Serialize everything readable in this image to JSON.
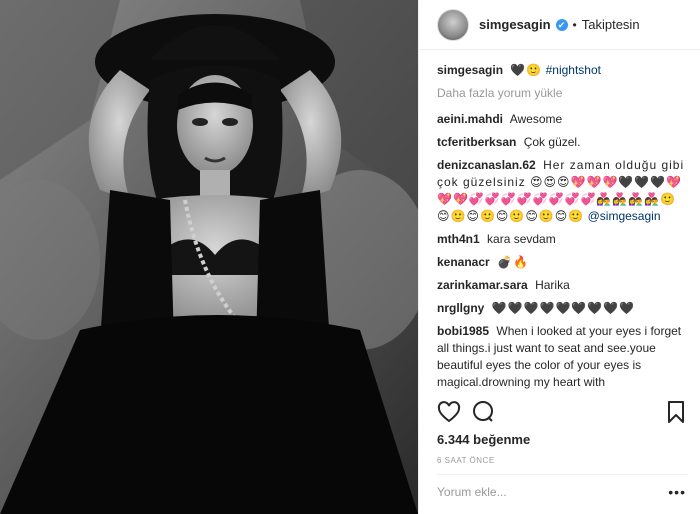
{
  "post": {
    "photo_alt": "",
    "author": {
      "username": "simgesagin",
      "verified_icon": "verified-badge-icon",
      "status": "Takiptesin",
      "separator": "•"
    },
    "caption": {
      "username": "simgesagin",
      "text": "🖤🙂",
      "hashtag": "#nightshot"
    },
    "load_more": "Daha fazla yorum yükle",
    "comments": [
      {
        "user": "aeini.mahdi",
        "text": "Awesome"
      },
      {
        "user": "tcferitberksan",
        "text": "Çok güzel."
      },
      {
        "user": "denizcanaslan.62",
        "text": "Her zaman olduğu gibi çok güzelsiniz 😍😍😍💖💖💖🖤🖤🖤💖💖💖💞💞💞💞💞💞💞💞👩‍❤️‍👨👩‍❤️‍👨👩‍❤️‍👨👩‍❤️‍👨🙂😊🙂😊🙂😊🙂😊🙂😊🙂",
        "mention": "@simgesagin"
      },
      {
        "user": "mth4n1",
        "text": "kara sevdam"
      },
      {
        "user": "kenanacr",
        "text": "💣🔥"
      },
      {
        "user": "zarinkamar.sara",
        "text": "Harika"
      },
      {
        "user": "nrgllgny",
        "text": "🖤🖤🖤🖤🖤🖤🖤🖤🖤"
      },
      {
        "user": "bobi1985",
        "text": "When i looked at your eyes i forget all things.i just want to seat and see.youe beautiful eyes the color of your eyes is magical.drowning my heart with"
      }
    ],
    "actions": {
      "like_icon": "heart-icon",
      "comment_icon": "comment-bubble-icon",
      "save_icon": "bookmark-icon"
    },
    "likes": "6.344 beğenme",
    "timestamp": "6 SAAT ÖNCE",
    "add_comment_placeholder": "Yorum ekle...",
    "more_icon": "more-options-icon",
    "more_glyph": "•••",
    "colors": {
      "link": "#003569",
      "muted": "#999999",
      "verified": "#3897f0",
      "text": "#262626"
    }
  }
}
